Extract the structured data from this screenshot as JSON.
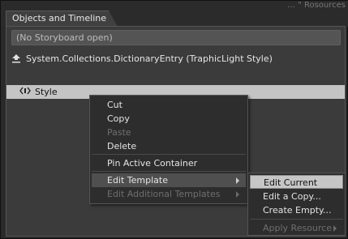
{
  "header": {
    "faint_text": "… \" Rosources"
  },
  "panel": {
    "tab_title": "Objects and Timeline",
    "storyboard_status": "(No Storyboard open)",
    "scope_label": "System.Collections.DictionaryEntry (TraphicLight Style)",
    "style_item": "Style"
  },
  "context_menu": {
    "items": [
      {
        "label": "Cut"
      },
      {
        "label": "Copy"
      },
      {
        "label": "Paste"
      },
      {
        "label": "Delete"
      },
      {
        "label": "Pin Active Container"
      },
      {
        "label": "Edit Template"
      },
      {
        "label": "Edit Additional Templates"
      }
    ]
  },
  "submenu": {
    "items": [
      {
        "label": "Edit Current"
      },
      {
        "label": "Edit a Copy..."
      },
      {
        "label": "Create Empty..."
      },
      {
        "label": "Apply Resource"
      }
    ]
  }
}
